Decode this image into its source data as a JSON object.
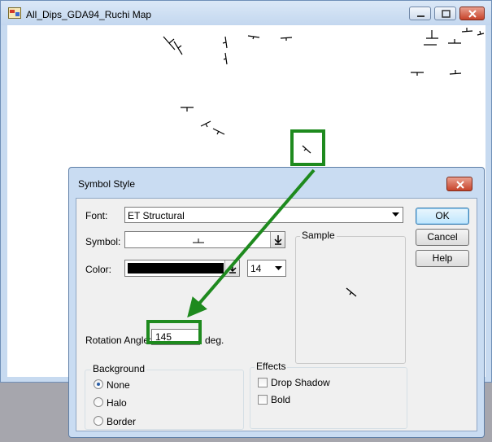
{
  "map_window": {
    "title": "All_Dips_GDA94_Ruchi Map",
    "controls": [
      "minimize-icon",
      "maximize-icon",
      "close-icon"
    ]
  },
  "dialog": {
    "title": "Symbol Style",
    "font_label": "Font:",
    "font_value": "ET Structural",
    "symbol_label": "Symbol:",
    "color_label": "Color:",
    "color_value": "#000000",
    "size_value": "14",
    "sample_label": "Sample",
    "rotation_label": "Rotation Angle:",
    "rotation_value": "145",
    "rotation_unit": "deg.",
    "buttons": {
      "ok": "OK",
      "cancel": "Cancel",
      "help": "Help"
    },
    "background": {
      "title": "Background",
      "options": [
        "None",
        "Halo",
        "Border"
      ],
      "selected": "None"
    },
    "effects": {
      "title": "Effects",
      "drop_shadow": "Drop Shadow",
      "bold": "Bold",
      "drop_shadow_checked": false,
      "bold_checked": false
    }
  },
  "annotation": {
    "highlight_color": "#1e8a1e"
  }
}
